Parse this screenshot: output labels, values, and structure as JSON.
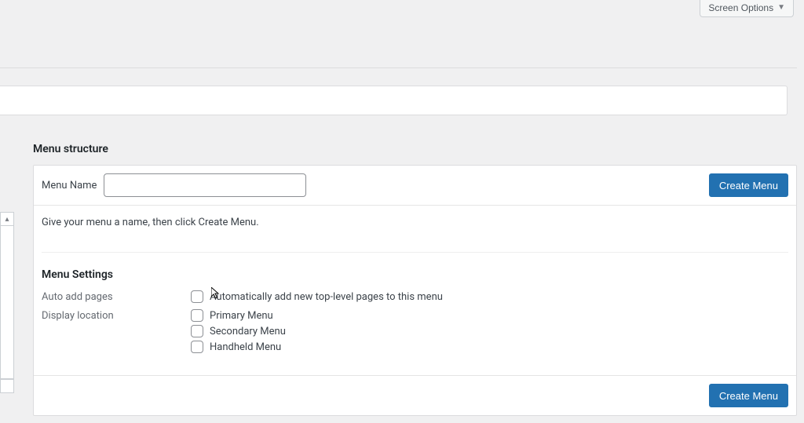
{
  "screenOptions": {
    "label": "Screen Options"
  },
  "section": {
    "title": "Menu structure"
  },
  "menuName": {
    "label": "Menu Name",
    "value": ""
  },
  "buttons": {
    "createMenu": "Create Menu"
  },
  "instruction": "Give your menu a name, then click Create Menu.",
  "settings": {
    "title": "Menu Settings",
    "rows": {
      "autoAdd": {
        "label": "Auto add pages",
        "options": [
          "Automatically add new top-level pages to this menu"
        ]
      },
      "display": {
        "label": "Display location",
        "options": [
          "Primary Menu",
          "Secondary Menu",
          "Handheld Menu"
        ]
      }
    }
  }
}
